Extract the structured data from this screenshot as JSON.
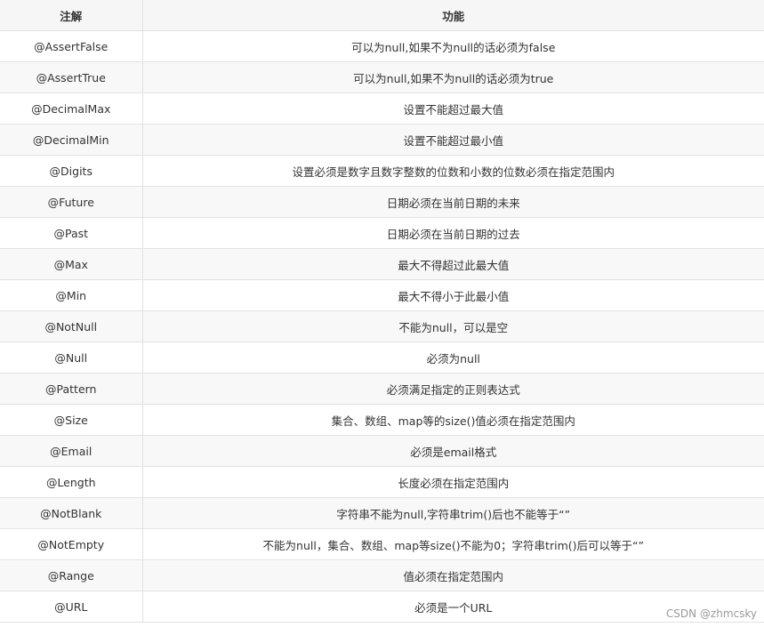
{
  "table": {
    "headers": [
      "注解",
      "功能"
    ],
    "rows": [
      {
        "annotation": "@AssertFalse",
        "function": "可以为null,如果不为null的话必须为false"
      },
      {
        "annotation": "@AssertTrue",
        "function": "可以为null,如果不为null的话必须为true"
      },
      {
        "annotation": "@DecimalMax",
        "function": "设置不能超过最大值"
      },
      {
        "annotation": "@DecimalMin",
        "function": "设置不能超过最小值"
      },
      {
        "annotation": "@Digits",
        "function": "设置必须是数字且数字整数的位数和小数的位数必须在指定范围内"
      },
      {
        "annotation": "@Future",
        "function": "日期必须在当前日期的未来"
      },
      {
        "annotation": "@Past",
        "function": "日期必须在当前日期的过去"
      },
      {
        "annotation": "@Max",
        "function": "最大不得超过此最大值"
      },
      {
        "annotation": "@Min",
        "function": "最大不得小于此最小值"
      },
      {
        "annotation": "@NotNull",
        "function": "不能为null，可以是空"
      },
      {
        "annotation": "@Null",
        "function": "必须为null"
      },
      {
        "annotation": "@Pattern",
        "function": "必须满足指定的正则表达式"
      },
      {
        "annotation": "@Size",
        "function": "集合、数组、map等的size()值必须在指定范围内"
      },
      {
        "annotation": "@Email",
        "function": "必须是email格式"
      },
      {
        "annotation": "@Length",
        "function": "长度必须在指定范围内"
      },
      {
        "annotation": "@NotBlank",
        "function": "字符串不能为null,字符串trim()后也不能等于“”"
      },
      {
        "annotation": "@NotEmpty",
        "function": "不能为null，集合、数组、map等size()不能为0；字符串trim()后可以等于“”"
      },
      {
        "annotation": "@Range",
        "function": "值必须在指定范围内"
      },
      {
        "annotation": "@URL",
        "function": "必须是一个URL"
      }
    ]
  },
  "watermark": "CSDN @zhmcsky"
}
